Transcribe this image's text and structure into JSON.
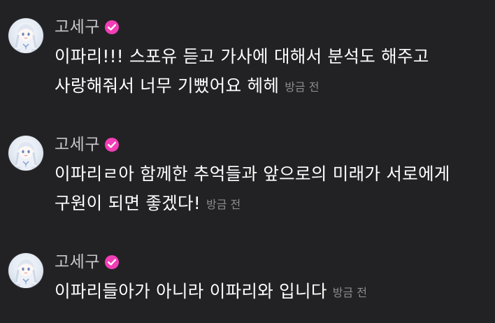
{
  "colors": {
    "background": "#222224",
    "nickname": "#c7c7cc",
    "message_text": "#ffffff",
    "timestamp": "#8b8b91",
    "verified_badge": "#f23eb6"
  },
  "messages": [
    {
      "nickname": "고세구",
      "avatar_icon": "anime-girl-avatar-icon",
      "badge_icon": "verified-check-icon",
      "text": "이파리!!! 스포유 듣고 가사에 대해서 분석도 해주고 사랑해줘서 너무 기뻤어요 헤헤",
      "timestamp": "방금 전"
    },
    {
      "nickname": "고세구",
      "avatar_icon": "anime-girl-avatar-icon",
      "badge_icon": "verified-check-icon",
      "text": "이파리ㄹ아 함께한 추억들과 앞으로의 미래가 서로에게 구원이 되면 좋겠다!",
      "timestamp": "방금 전"
    },
    {
      "nickname": "고세구",
      "avatar_icon": "anime-girl-avatar-icon",
      "badge_icon": "verified-check-icon",
      "text": "이파리들아가 아니라 이파리와 입니다",
      "timestamp": "방금 전"
    }
  ]
}
